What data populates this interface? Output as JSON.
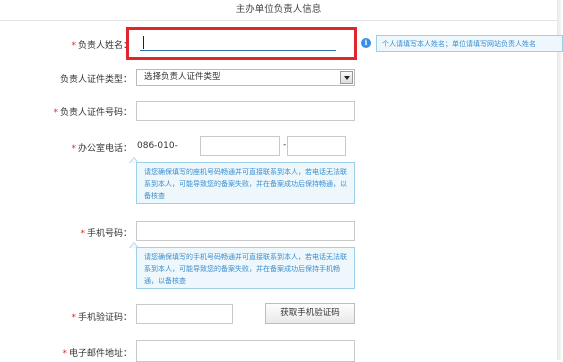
{
  "header": {
    "title": "主办单位负责人信息"
  },
  "fields": {
    "name": {
      "required": "*",
      "label": "负责人姓名：",
      "value": "",
      "tip": "个人请填写本人姓名；单位请填写网站负责人姓名"
    },
    "id_type": {
      "label": "负责人证件类型：",
      "selected": "选择负责人证件类型"
    },
    "id_number": {
      "required": "*",
      "label": "负责人证件号码："
    },
    "office_phone": {
      "required": "*",
      "label": "办公室电话：",
      "prefix": "086-010-",
      "separator": "-",
      "tip": "请您确保填写的座机号码畅通并可直接联系到本人，若电话无法联系到本人，可能导致您的备案失败，并在备案成功后保持畅通，以备核查"
    },
    "mobile": {
      "required": "*",
      "label": "手机号码：",
      "tip": "请您确保填写的手机号码畅通并可直接联系到本人，若电话无法联系到本人，可能导致您的备案失败，并在备案成功后保持手机畅通，以备核查"
    },
    "sms_code": {
      "required": "*",
      "label": "手机验证码：",
      "button": "获取手机验证码"
    },
    "email": {
      "required": "*",
      "label": "电子邮件地址："
    }
  },
  "colors": {
    "highlight": "#e0262b",
    "tip_bg": "#eef7fc",
    "tip_text": "#3b8ecf",
    "required": "#e0262b"
  },
  "icons": {
    "info": "info-icon"
  }
}
